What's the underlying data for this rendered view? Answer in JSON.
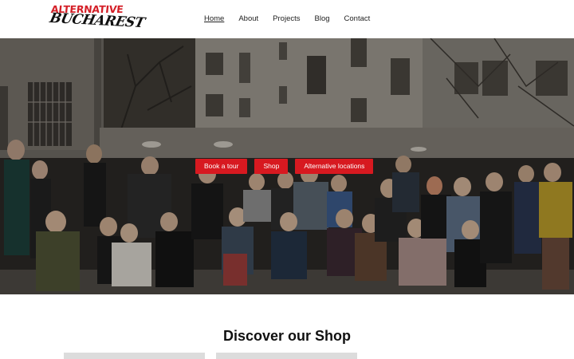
{
  "logo": {
    "line1": "ALTERNATIVE",
    "line2": "BUCHAREST",
    "colors": {
      "line1": "#d41f27",
      "line2": "#111111"
    }
  },
  "nav": {
    "items": [
      {
        "label": "Home",
        "active": true
      },
      {
        "label": "About"
      },
      {
        "label": "Projects"
      },
      {
        "label": "Blog"
      },
      {
        "label": "Contact"
      }
    ]
  },
  "hero": {
    "image": "group-photo-in-courtyard",
    "buttons": [
      {
        "label": "Book a tour"
      },
      {
        "label": "Shop"
      },
      {
        "label": "Alternative locations"
      }
    ],
    "button_color": "#d71920"
  },
  "shop": {
    "title": "Discover our Shop"
  }
}
